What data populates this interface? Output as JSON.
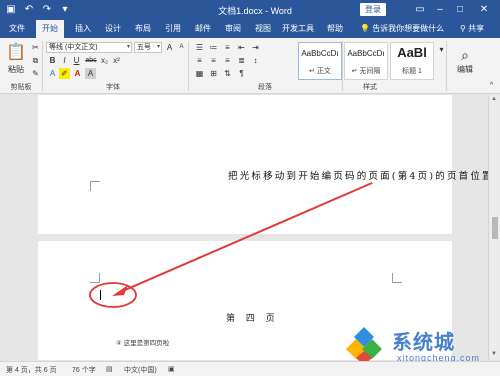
{
  "titlebar": {
    "title": "文档1.docx - Word",
    "login": "登录",
    "icons": [
      "save-icon",
      "undo-icon",
      "redo-icon",
      "customize-icon"
    ],
    "window_icons": [
      "ribbon-display-icon",
      "minimize-icon",
      "maximize-icon",
      "close-icon"
    ]
  },
  "tabs": [
    {
      "label": "文件"
    },
    {
      "label": "开始",
      "active": true
    },
    {
      "label": "插入"
    },
    {
      "label": "设计"
    },
    {
      "label": "布局"
    },
    {
      "label": "引用"
    },
    {
      "label": "邮件"
    },
    {
      "label": "审阅"
    },
    {
      "label": "视图"
    },
    {
      "label": "开发工具"
    },
    {
      "label": "帮助"
    }
  ],
  "tellme": "告诉我你想要做什么",
  "share": "共享",
  "ribbon": {
    "clipboard": {
      "paste": "粘贴",
      "label": "剪贴板"
    },
    "font": {
      "name": "等线 (中文正文)",
      "size": "五号",
      "label": "字体",
      "buttons": [
        "B",
        "I",
        "U",
        "abc",
        "x₂",
        "x²",
        "A",
        "A"
      ]
    },
    "paragraph": {
      "label": "段落"
    },
    "styles": {
      "label": "样式",
      "items": [
        {
          "sample": "AaBbCcDı",
          "name": "↵ 正文"
        },
        {
          "sample": "AaBbCcDı",
          "name": "↵ 无间隔"
        },
        {
          "sample": "AaBl",
          "name": "标题 1"
        }
      ]
    },
    "editing": {
      "label": "编辑"
    }
  },
  "document": {
    "instruction": "把光标移动到开始编页码的页面(第4页)的页首位置",
    "page_heading": "第 四 页",
    "footnote": "④   这里是第四页啦"
  },
  "statusbar": {
    "page": "第 4 页，共 6 页",
    "words": "76 个字",
    "lang": "中文(中国)"
  },
  "watermark": {
    "brand": "系统城",
    "url": "xitongcheng.com"
  },
  "colors": {
    "accent": "#2b579a",
    "annotation": "#e03a3a"
  }
}
